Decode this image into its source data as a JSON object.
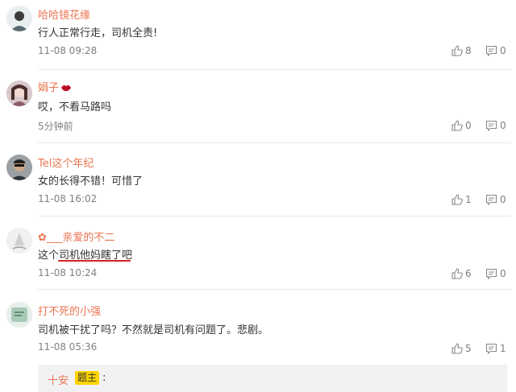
{
  "comments": [
    {
      "user": "哈哈镜花缘",
      "text": "行人正常行走，司机全责!",
      "time": "11-08 09:28",
      "likes": "8",
      "replies": "0"
    },
    {
      "user": "娟子",
      "text": "哎，不看马路吗",
      "time": "5分钟前",
      "likes": "0",
      "replies": "0"
    },
    {
      "user": "Tel这个年纪",
      "text": "女的长得不错！可惜了",
      "time": "11-08 16:02",
      "likes": "1",
      "replies": "0"
    },
    {
      "user": "✿___亲爱的不二",
      "text": "这个司机他妈瞎了吧",
      "time": "11-08 10:24",
      "likes": "6",
      "replies": "0"
    },
    {
      "user": "打不死的小强",
      "text": "司机被干扰了吗？不然就是司机有问题了。悲剧。",
      "time": "11-08 05:36",
      "likes": "5",
      "replies": "1"
    }
  ],
  "reply": {
    "user": "十安",
    "badge": "题主",
    "colon": ":"
  },
  "colors": {
    "username": "#eb7350",
    "text": "#333333",
    "meta": "#808080",
    "badge": "#ffd400",
    "underline": "#d42323"
  },
  "icons": {
    "like": "thumbs-up-icon",
    "comment": "comment-bubble-icon",
    "emoji": "lips-emoji-icon"
  }
}
